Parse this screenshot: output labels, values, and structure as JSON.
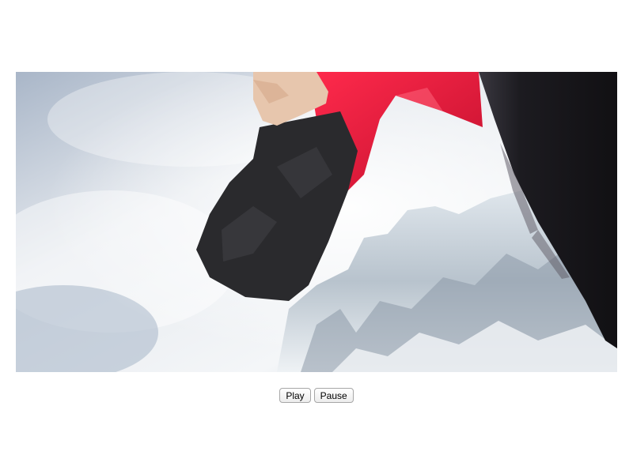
{
  "video": {
    "icon": "video-player",
    "colors": {
      "sky": "#d7dde5",
      "sleeve": "#e8173a",
      "cuff": "#2b2b2d",
      "pants": "#1f1d22",
      "snow": "#e8edf2"
    }
  },
  "controls": {
    "play_label": "Play",
    "pause_label": "Pause"
  }
}
